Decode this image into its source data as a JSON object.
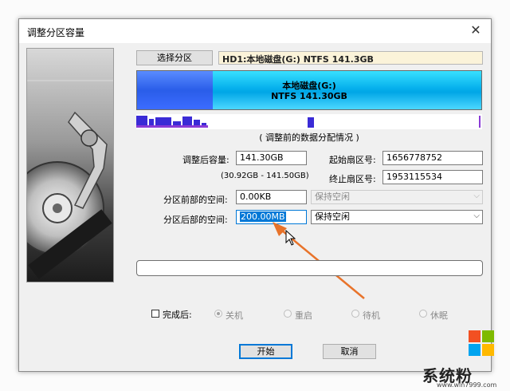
{
  "window": {
    "title": "调整分区容量",
    "close_symbol": "✕"
  },
  "select_partition_button": "选择分区",
  "disk_info": "HD1:本地磁盘(G:) NTFS 141.3GB",
  "partition": {
    "name": "本地磁盘(G:)",
    "details": "NTFS 141.30GB",
    "used_fraction": 0.22
  },
  "caption": "( 调整前的数据分配情况 )",
  "fields": {
    "size_label": "调整后容量:",
    "size_value": "141.30GB",
    "size_range": "(30.92GB - 141.50GB)",
    "start_sector_label": "起始扇区号:",
    "start_sector_value": "1656778752",
    "end_sector_label": "终止扇区号:",
    "end_sector_value": "1953115534",
    "space_before_label": "分区前部的空间:",
    "space_before_value": "0.00KB",
    "space_before_option": "保持空闲",
    "space_after_label": "分区后部的空间:",
    "space_after_value": "200.00MB",
    "space_after_option": "保持空闲"
  },
  "after_complete": {
    "label": "完成后:",
    "options": [
      "关机",
      "重启",
      "待机",
      "休眠"
    ]
  },
  "buttons": {
    "start": "开始",
    "cancel": "取消"
  },
  "colors": {
    "accent": "#0078d7",
    "arrow": "#e8732a",
    "partition_fill": "#00a6e6",
    "used_fill": "#2a5de9"
  },
  "watermark": {
    "name": "系统粉",
    "url": "www.win7999.com"
  }
}
